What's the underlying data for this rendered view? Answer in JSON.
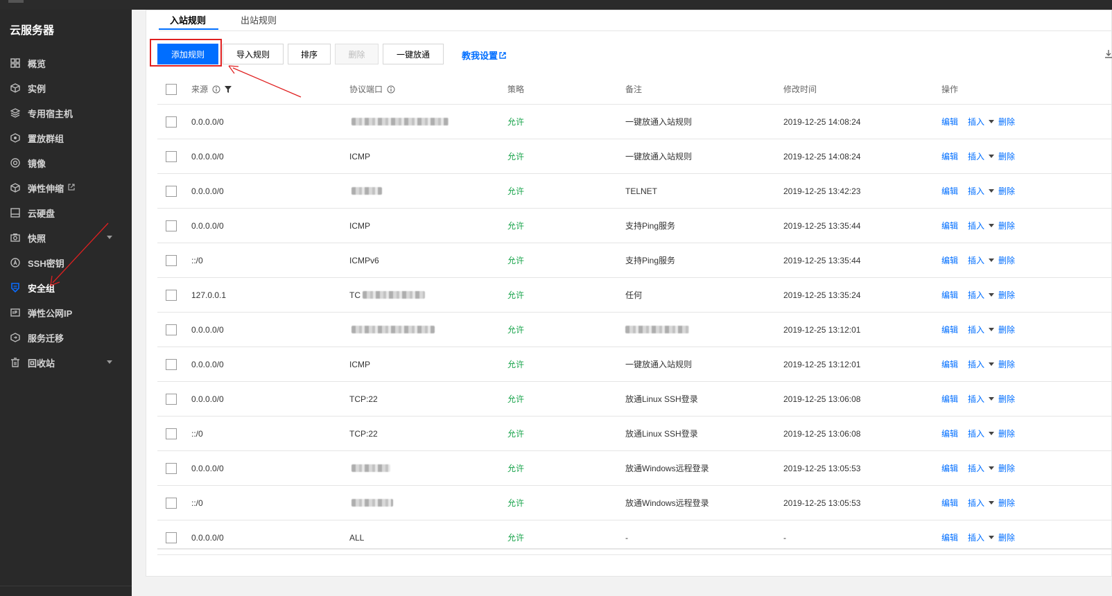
{
  "sidebar": {
    "title": "云服务器",
    "items": [
      {
        "label": "概览",
        "icon": "grid-icon"
      },
      {
        "label": "实例",
        "icon": "cube-icon"
      },
      {
        "label": "专用宿主机",
        "icon": "stack-icon"
      },
      {
        "label": "置放群组",
        "icon": "hexagon-icon"
      },
      {
        "label": "镜像",
        "icon": "disc-icon"
      },
      {
        "label": "弹性伸缩",
        "icon": "cube-icon",
        "external": true
      },
      {
        "label": "云硬盘",
        "icon": "disk-icon"
      },
      {
        "label": "快照",
        "icon": "camera-icon",
        "expandable": true
      },
      {
        "label": "SSH密钥",
        "icon": "key-icon"
      },
      {
        "label": "安全组",
        "icon": "shield-icon",
        "active": true
      },
      {
        "label": "弹性公网IP",
        "icon": "ip-icon"
      },
      {
        "label": "服务迁移",
        "icon": "migrate-icon"
      },
      {
        "label": "回收站",
        "icon": "trash-icon",
        "expandable": true
      }
    ]
  },
  "tabs": {
    "inbound": "入站规则",
    "outbound": "出站规则"
  },
  "toolbar": {
    "add": "添加规则",
    "import": "导入规则",
    "sort": "排序",
    "delete": "删除",
    "open_all": "一键放通",
    "help": "教我设置"
  },
  "table": {
    "headers": {
      "source": "来源",
      "protocol": "协议端口",
      "policy": "策略",
      "note": "备注",
      "time": "修改时间",
      "ops": "操作"
    },
    "ops": {
      "edit": "编辑",
      "insert": "插入",
      "delete": "删除"
    },
    "rows": [
      {
        "source": "0.0.0.0/0",
        "protocol": "",
        "protocol_blurred": true,
        "policy": "允许",
        "note": "一键放通入站规则",
        "time": "2019-12-25 14:08:24"
      },
      {
        "source": "0.0.0.0/0",
        "protocol": "ICMP",
        "policy": "允许",
        "note": "一键放通入站规则",
        "time": "2019-12-25 14:08:24"
      },
      {
        "source": "0.0.0.0/0",
        "protocol": "",
        "protocol_blurred": true,
        "policy": "允许",
        "note": "TELNET",
        "time": "2019-12-25 13:42:23"
      },
      {
        "source": "0.0.0.0/0",
        "protocol": "ICMP",
        "policy": "允许",
        "note": "支持Ping服务",
        "time": "2019-12-25 13:35:44"
      },
      {
        "source": "::/0",
        "protocol": "ICMPv6",
        "policy": "允许",
        "note": "支持Ping服务",
        "time": "2019-12-25 13:35:44"
      },
      {
        "source": "127.0.0.1",
        "protocol": "TC",
        "protocol_blurred": true,
        "policy": "允许",
        "note": "任何",
        "time": "2019-12-25 13:35:24"
      },
      {
        "source": "0.0.0.0/0",
        "protocol": "",
        "protocol_blurred": true,
        "policy": "允许",
        "note": "",
        "note_blurred": true,
        "time": "2019-12-25 13:12:01"
      },
      {
        "source": "0.0.0.0/0",
        "protocol": "ICMP",
        "policy": "允许",
        "note": "一键放通入站规则",
        "time": "2019-12-25 13:12:01"
      },
      {
        "source": "0.0.0.0/0",
        "protocol": "TCP:22",
        "policy": "允许",
        "note": "放通Linux SSH登录",
        "time": "2019-12-25 13:06:08"
      },
      {
        "source": "::/0",
        "protocol": "TCP:22",
        "policy": "允许",
        "note": "放通Linux SSH登录",
        "time": "2019-12-25 13:06:08"
      },
      {
        "source": "0.0.0.0/0",
        "protocol": "",
        "protocol_blurred": true,
        "policy": "允许",
        "note": "放通Windows远程登录",
        "time": "2019-12-25 13:05:53"
      },
      {
        "source": "::/0",
        "protocol": "",
        "protocol_blurred": true,
        "policy": "允许",
        "note": "放通Windows远程登录",
        "time": "2019-12-25 13:05:53"
      },
      {
        "source": "0.0.0.0/0",
        "protocol": "ALL",
        "policy": "允许",
        "note": "-",
        "time": "-"
      }
    ]
  },
  "colors": {
    "accent": "#006eff",
    "allow": "#17a34a",
    "annotation": "#e02020",
    "sidebar_bg": "#292929"
  }
}
